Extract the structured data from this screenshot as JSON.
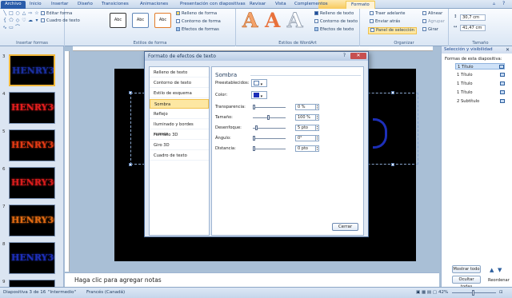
{
  "tabs": {
    "file": "Archivo",
    "items": [
      "Inicio",
      "Insertar",
      "Diseño",
      "Transiciones",
      "Animaciones",
      "Presentación con diapositivas",
      "Revisar",
      "Vista",
      "Complementos"
    ],
    "selected": "Formato"
  },
  "ribbon": {
    "insert_shapes": {
      "edit_shape": "Editar forma",
      "text_box": "Cuadro de texto",
      "label": "Insertar formas"
    },
    "shape_styles": {
      "style_boxes": [
        "Abc",
        "Abc",
        "Abc"
      ],
      "fill": "Relleno de forma",
      "outline": "Contorno de forma",
      "effects": "Efectos de formas",
      "label": "Estilos de forma"
    },
    "wordart": {
      "letter": "A",
      "text_fill": "Relleno de texto",
      "text_outline": "Contorno de texto",
      "text_effects": "Efectos de texto",
      "label": "Estilos de WordArt"
    },
    "arrange": {
      "bring_forward": "Traer adelante",
      "send_backward": "Enviar atrás",
      "selection_pane": "Panel de selección",
      "align": "Alinear",
      "group": "Agrupar",
      "rotate": "Girar",
      "label": "Organizar"
    },
    "size": {
      "height": "30,7 cm",
      "width": "41,47 cm",
      "label": "Tamaño"
    }
  },
  "thumbnails": [
    {
      "num": "3",
      "text": "HENRY30",
      "color": "#1a2fa0",
      "selected": true
    },
    {
      "num": "4",
      "text": "HENRY30",
      "color": "#e21d1d",
      "selected": false
    },
    {
      "num": "5",
      "text": "HENRY30",
      "color": "#e23a14",
      "selected": false
    },
    {
      "num": "6",
      "text": "HENRY30",
      "color": "#d81c1c",
      "selected": false
    },
    {
      "num": "7",
      "text": "HENRY30",
      "color": "#e06a12",
      "selected": false
    },
    {
      "num": "8",
      "text": "HENRY30",
      "color": "#1d2fb8",
      "selected": false
    },
    {
      "num": "9",
      "text": "",
      "color": "#000000",
      "selected": false
    }
  ],
  "notes": {
    "placeholder": "Haga clic para agregar notas"
  },
  "selection_pane": {
    "title": "Selección y visibilidad",
    "subtitle": "Formas de esta diapositiva:",
    "items": [
      "1 Título",
      "1 Título",
      "1 Título",
      "1 Título",
      "2 Subtítulo"
    ],
    "show_all": "Mostrar todo",
    "hide_all": "Ocultar todas",
    "reorder": "Reordenar"
  },
  "dialog": {
    "title": "Formato de efectos de texto",
    "nav": [
      "Relleno de texto",
      "Contorno de texto",
      "Estilo de esquema",
      "Sombra",
      "Reflejo",
      "Iluminado y bordes suaves",
      "Formato 3D",
      "Giro 3D",
      "Cuadro de texto"
    ],
    "selected_nav": "Sombra",
    "panel_title": "Sombra",
    "presets_label": "Preestablecidos:",
    "color_label": "Color:",
    "transparency_label": "Transparencia:",
    "transparency_value": "0 %",
    "size_label": "Tamaño:",
    "size_value": "100 %",
    "blur_label": "Desenfoque:",
    "blur_value": "5 pto",
    "angle_label": "Ángulo:",
    "angle_value": "0°",
    "distance_label": "Distancia:",
    "distance_value": "0 pto",
    "close_label": "Cerrar"
  },
  "status": {
    "slide_info": "Diapositiva 3 de 16",
    "theme": "\"Intermedio\"",
    "language": "Francés (Canadá)",
    "zoom": "42%"
  }
}
